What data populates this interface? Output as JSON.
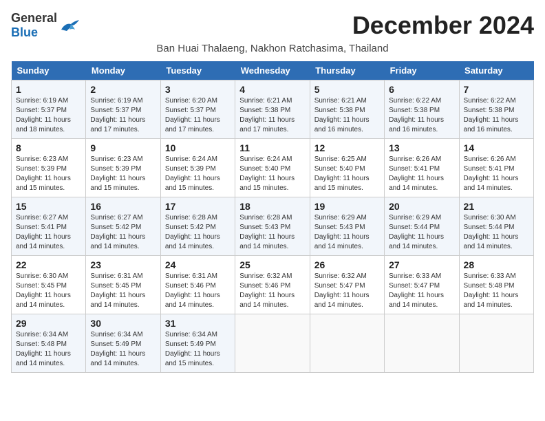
{
  "logo": {
    "general": "General",
    "blue": "Blue"
  },
  "header": {
    "month_title": "December 2024",
    "location": "Ban Huai Thalaeng, Nakhon Ratchasima, Thailand"
  },
  "days_of_week": [
    "Sunday",
    "Monday",
    "Tuesday",
    "Wednesday",
    "Thursday",
    "Friday",
    "Saturday"
  ],
  "weeks": [
    [
      {
        "day": "1",
        "sunrise": "6:19 AM",
        "sunset": "5:37 PM",
        "daylight": "11 hours and 18 minutes."
      },
      {
        "day": "2",
        "sunrise": "6:19 AM",
        "sunset": "5:37 PM",
        "daylight": "11 hours and 17 minutes."
      },
      {
        "day": "3",
        "sunrise": "6:20 AM",
        "sunset": "5:37 PM",
        "daylight": "11 hours and 17 minutes."
      },
      {
        "day": "4",
        "sunrise": "6:21 AM",
        "sunset": "5:38 PM",
        "daylight": "11 hours and 17 minutes."
      },
      {
        "day": "5",
        "sunrise": "6:21 AM",
        "sunset": "5:38 PM",
        "daylight": "11 hours and 16 minutes."
      },
      {
        "day": "6",
        "sunrise": "6:22 AM",
        "sunset": "5:38 PM",
        "daylight": "11 hours and 16 minutes."
      },
      {
        "day": "7",
        "sunrise": "6:22 AM",
        "sunset": "5:38 PM",
        "daylight": "11 hours and 16 minutes."
      }
    ],
    [
      {
        "day": "8",
        "sunrise": "6:23 AM",
        "sunset": "5:39 PM",
        "daylight": "11 hours and 15 minutes."
      },
      {
        "day": "9",
        "sunrise": "6:23 AM",
        "sunset": "5:39 PM",
        "daylight": "11 hours and 15 minutes."
      },
      {
        "day": "10",
        "sunrise": "6:24 AM",
        "sunset": "5:39 PM",
        "daylight": "11 hours and 15 minutes."
      },
      {
        "day": "11",
        "sunrise": "6:24 AM",
        "sunset": "5:40 PM",
        "daylight": "11 hours and 15 minutes."
      },
      {
        "day": "12",
        "sunrise": "6:25 AM",
        "sunset": "5:40 PM",
        "daylight": "11 hours and 15 minutes."
      },
      {
        "day": "13",
        "sunrise": "6:26 AM",
        "sunset": "5:41 PM",
        "daylight": "11 hours and 14 minutes."
      },
      {
        "day": "14",
        "sunrise": "6:26 AM",
        "sunset": "5:41 PM",
        "daylight": "11 hours and 14 minutes."
      }
    ],
    [
      {
        "day": "15",
        "sunrise": "6:27 AM",
        "sunset": "5:41 PM",
        "daylight": "11 hours and 14 minutes."
      },
      {
        "day": "16",
        "sunrise": "6:27 AM",
        "sunset": "5:42 PM",
        "daylight": "11 hours and 14 minutes."
      },
      {
        "day": "17",
        "sunrise": "6:28 AM",
        "sunset": "5:42 PM",
        "daylight": "11 hours and 14 minutes."
      },
      {
        "day": "18",
        "sunrise": "6:28 AM",
        "sunset": "5:43 PM",
        "daylight": "11 hours and 14 minutes."
      },
      {
        "day": "19",
        "sunrise": "6:29 AM",
        "sunset": "5:43 PM",
        "daylight": "11 hours and 14 minutes."
      },
      {
        "day": "20",
        "sunrise": "6:29 AM",
        "sunset": "5:44 PM",
        "daylight": "11 hours and 14 minutes."
      },
      {
        "day": "21",
        "sunrise": "6:30 AM",
        "sunset": "5:44 PM",
        "daylight": "11 hours and 14 minutes."
      }
    ],
    [
      {
        "day": "22",
        "sunrise": "6:30 AM",
        "sunset": "5:45 PM",
        "daylight": "11 hours and 14 minutes."
      },
      {
        "day": "23",
        "sunrise": "6:31 AM",
        "sunset": "5:45 PM",
        "daylight": "11 hours and 14 minutes."
      },
      {
        "day": "24",
        "sunrise": "6:31 AM",
        "sunset": "5:46 PM",
        "daylight": "11 hours and 14 minutes."
      },
      {
        "day": "25",
        "sunrise": "6:32 AM",
        "sunset": "5:46 PM",
        "daylight": "11 hours and 14 minutes."
      },
      {
        "day": "26",
        "sunrise": "6:32 AM",
        "sunset": "5:47 PM",
        "daylight": "11 hours and 14 minutes."
      },
      {
        "day": "27",
        "sunrise": "6:33 AM",
        "sunset": "5:47 PM",
        "daylight": "11 hours and 14 minutes."
      },
      {
        "day": "28",
        "sunrise": "6:33 AM",
        "sunset": "5:48 PM",
        "daylight": "11 hours and 14 minutes."
      }
    ],
    [
      {
        "day": "29",
        "sunrise": "6:34 AM",
        "sunset": "5:48 PM",
        "daylight": "11 hours and 14 minutes."
      },
      {
        "day": "30",
        "sunrise": "6:34 AM",
        "sunset": "5:49 PM",
        "daylight": "11 hours and 14 minutes."
      },
      {
        "day": "31",
        "sunrise": "6:34 AM",
        "sunset": "5:49 PM",
        "daylight": "11 hours and 15 minutes."
      },
      null,
      null,
      null,
      null
    ]
  ]
}
